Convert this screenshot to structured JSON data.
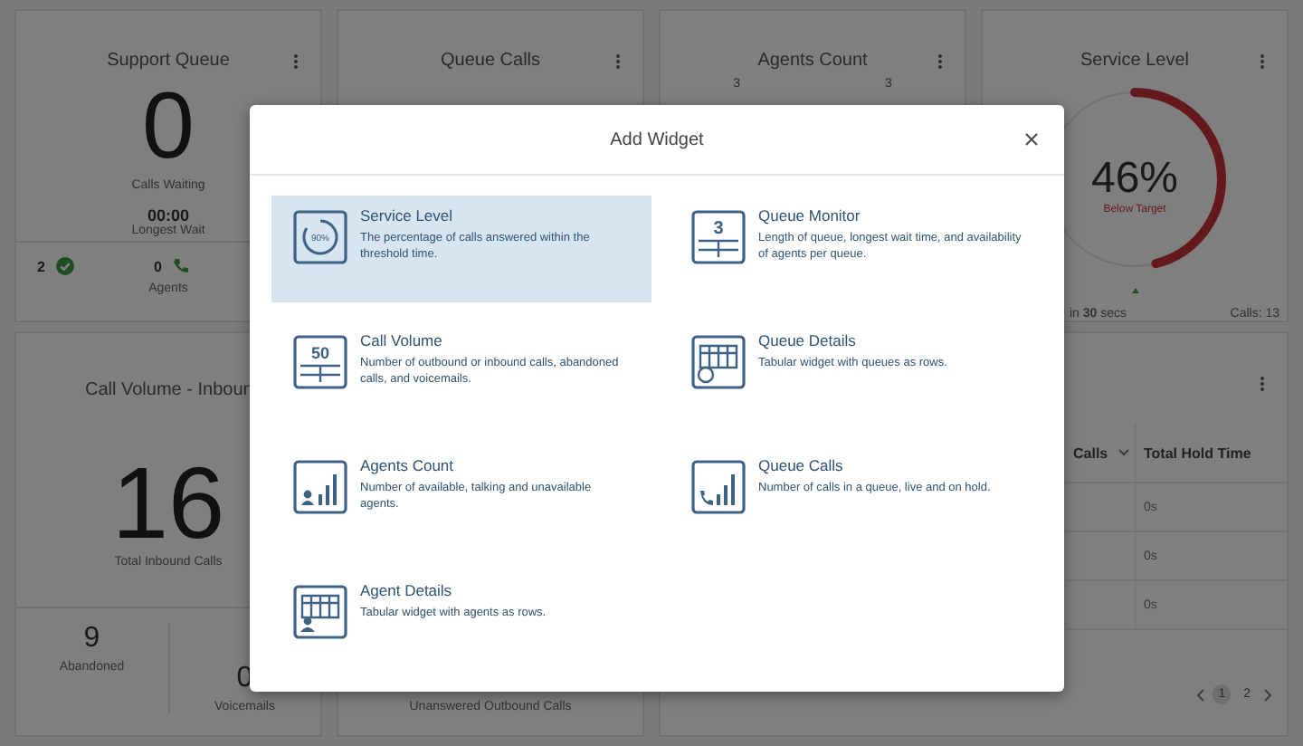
{
  "dashboard": {
    "support_queue": {
      "title": "Support Queue",
      "count": "0",
      "count_label": "Calls Waiting",
      "wait": "00:00",
      "wait_label": "Longest Wait",
      "agents": [
        {
          "value": "2",
          "kind": "available"
        },
        {
          "value": "0",
          "kind": "talking"
        }
      ],
      "agents_label": "Agents"
    },
    "queue_calls": {
      "title": "Queue Calls"
    },
    "agents_count": {
      "title": "Agents Count",
      "chart_labels": [
        "3",
        "3"
      ]
    },
    "service_level": {
      "title": "Service Level",
      "level": 0.46,
      "percent": "46%",
      "status": "Below Target",
      "threshold": "in **30** secs",
      "calls": "Calls: 13"
    },
    "call_volume": {
      "title": "Call Volume - Inboun",
      "total": "16",
      "total_label": "Total Inbound Calls",
      "breakdown": [
        {
          "value": "9",
          "label": "Abandoned"
        },
        {
          "value": "0",
          "label": "Voicemails"
        }
      ]
    },
    "outbound": {
      "label": "Unanswered Outbound Calls"
    },
    "queue_table": {
      "columns": [
        {
          "label": "Calls",
          "sortable": true
        },
        {
          "label": "Total Hold Time",
          "sortable": false
        }
      ],
      "rows": [
        {
          "hold_time": "0s"
        },
        {
          "hold_time": "0s"
        },
        {
          "hold_time": "0s"
        }
      ],
      "pages": [
        {
          "label": "1",
          "selected": true
        },
        {
          "label": "2",
          "selected": false
        }
      ]
    }
  },
  "modal": {
    "title": "Add Widget",
    "widgets": [
      {
        "kind": "service_level",
        "icon_text": "90%",
        "title": "Service Level",
        "description": "The percentage of calls answered within the threshold time.",
        "selected": true
      },
      {
        "kind": "queue_monitor",
        "icon_text": "3",
        "title": "Queue Monitor",
        "description": "Length of queue, longest wait time, and availability of agents per queue.",
        "selected": false
      },
      {
        "kind": "call_volume",
        "icon_text": "50",
        "title": "Call Volume",
        "description": "Number of outbound or inbound calls, abandoned calls, and voicemails.",
        "selected": false
      },
      {
        "kind": "queue_details",
        "title": "Queue Details",
        "description": "Tabular widget with queues as rows.",
        "selected": false
      },
      {
        "kind": "agents_count",
        "title": "Agents Count",
        "description": "Number of available, talking and unavailable agents.",
        "selected": false
      },
      {
        "kind": "queue_calls",
        "title": "Queue Calls",
        "description": "Number of calls in a queue, live and on hold.",
        "selected": false
      },
      {
        "kind": "agent_details",
        "title": "Agent Details",
        "description": "Tabular widget with agents as rows.",
        "selected": false
      }
    ]
  }
}
